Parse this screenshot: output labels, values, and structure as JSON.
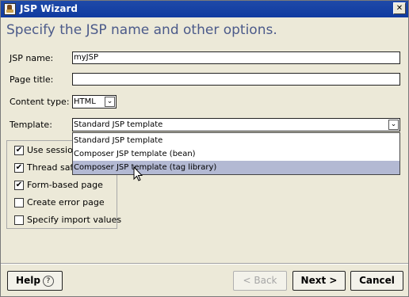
{
  "window": {
    "title": "JSP Wizard",
    "close_glyph": "✕"
  },
  "headline": "Specify the JSP name and other options.",
  "form": {
    "jsp_name_label": "JSP name:",
    "jsp_name_value": "myJSP",
    "page_title_label": "Page title:",
    "page_title_value": "",
    "content_type_label": "Content type:",
    "content_type_value": "HTML",
    "template_label": "Template:",
    "template_value": "Standard JSP template"
  },
  "options": [
    {
      "label": "Use session",
      "checked": true
    },
    {
      "label": "Thread safe",
      "checked": true
    },
    {
      "label": "Form-based page",
      "checked": true
    },
    {
      "label": "Create error page",
      "checked": false
    },
    {
      "label": "Specify import values",
      "checked": false
    }
  ],
  "template_dropdown": {
    "items": [
      "Standard JSP template",
      "Composer JSP template (bean)",
      "Composer JSP template (tag library)"
    ],
    "highlighted_index": 2
  },
  "buttons": {
    "help": "Help",
    "back": "< Back",
    "next": "Next >",
    "cancel": "Cancel"
  },
  "icons": {
    "app": "coffee-cup-icon",
    "close": "close-icon",
    "chevron": "chevron-down-icon",
    "help": "question-mark-icon",
    "cursor": "mouse-pointer-icon"
  },
  "colors": {
    "title_bar": "#1f4aa8",
    "headline": "#4b5a8a",
    "selection": "#b3b9d3",
    "dialog_bg": "#ece9d8"
  }
}
